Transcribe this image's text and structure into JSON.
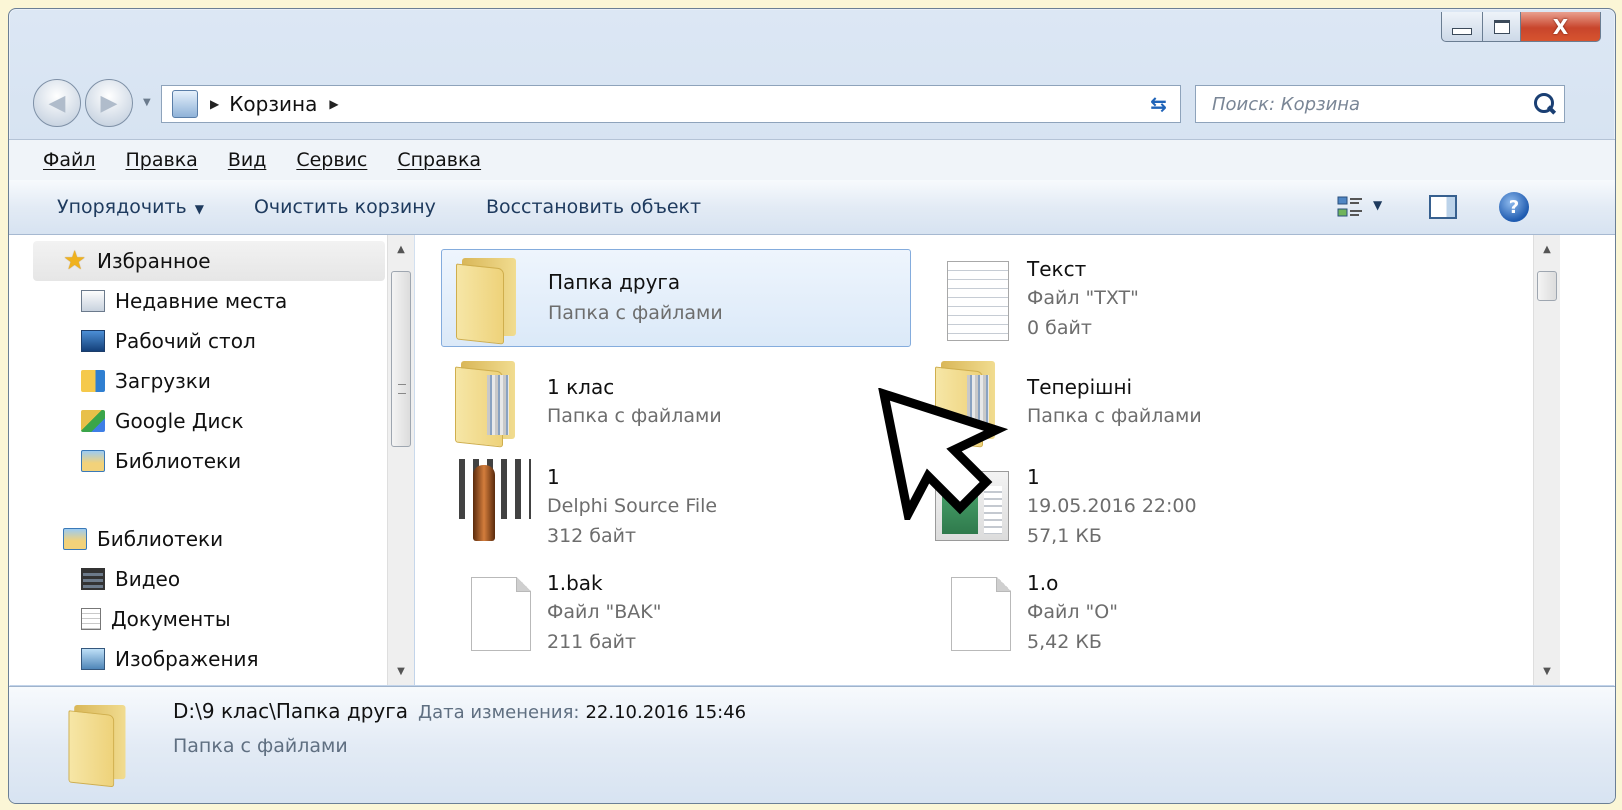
{
  "window": {
    "caption_buttons": {
      "minimize": "minimize",
      "maximize": "maximize",
      "close": "X"
    }
  },
  "address": {
    "crumb": "Корзина",
    "search_placeholder": "Поиск: Корзина"
  },
  "menu": [
    "Файл",
    "Правка",
    "Вид",
    "Сервис",
    "Справка"
  ],
  "commands": {
    "organize": "Упорядочить",
    "empty_bin": "Очистить корзину",
    "restore": "Восстановить объект"
  },
  "nav": {
    "favorites": "Избранное",
    "recent": "Недавние места",
    "desktop": "Рабочий стол",
    "downloads": "Загрузки",
    "google_drive": "Google Диск",
    "libraries_fav": "Библиотеки",
    "libraries": "Библиотеки",
    "video": "Видео",
    "documents": "Документы",
    "images": "Изображения"
  },
  "files": [
    {
      "name": "Папка друга",
      "line2": "Папка с файлами",
      "line3": "",
      "icon": "folder-icon",
      "selected": true
    },
    {
      "name": "Текст",
      "line2": "Файл \"TXT\"",
      "line3": "0 байт",
      "icon": "text-file-icon"
    },
    {
      "name": "1 клас",
      "line2": "Папка с файлами",
      "line3": "",
      "icon": "folder-icon"
    },
    {
      "name": "Теперішні",
      "line2": "Папка с файлами",
      "line3": "",
      "icon": "folder-icon"
    },
    {
      "name": "1",
      "line2": "Delphi Source File",
      "line3": "312 байт",
      "icon": "delphi-icon"
    },
    {
      "name": "1",
      "line2": "19.05.2016 22:00",
      "line3": "57,1 КБ",
      "icon": "executable-icon"
    },
    {
      "name": "1.bak",
      "line2": "Файл \"BAK\"",
      "line3": "211 байт",
      "icon": "blank-file-icon"
    },
    {
      "name": "1.o",
      "line2": "Файл \"O\"",
      "line3": "5,42 КБ",
      "icon": "blank-file-icon"
    }
  ],
  "details": {
    "path": "D:\\9 клас\\Папка друга",
    "modified_label": "Дата изменения:",
    "modified_value": "22.10.2016 15:46",
    "type": "Папка с файлами"
  },
  "colors": {
    "page_bg": "#fbf6d6",
    "selection_border": "#84acdd",
    "close_button": "#c8452c"
  }
}
